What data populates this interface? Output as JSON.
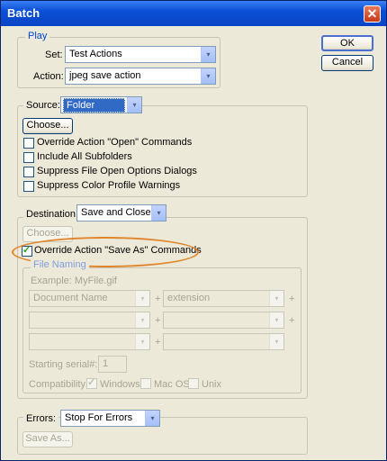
{
  "window": {
    "title": "Batch",
    "close_glyph": "✕"
  },
  "buttons": {
    "ok": "OK",
    "cancel": "Cancel"
  },
  "play": {
    "legend": "Play",
    "set_label": "Set:",
    "set_value": "Test Actions",
    "action_label": "Action:",
    "action_value": "jpeg save action"
  },
  "source": {
    "label": "Source:",
    "value": "Folder",
    "choose": "Choose...",
    "checks": [
      "Override Action \"Open\" Commands",
      "Include All Subfolders",
      "Suppress File Open Options Dialogs",
      "Suppress Color Profile Warnings"
    ]
  },
  "destination": {
    "label": "Destination:",
    "value": "Save and Close",
    "choose": "Choose...",
    "override": "Override Action \"Save As\" Commands",
    "file_naming": {
      "legend": "File Naming",
      "example": "Example: MyFile.gif",
      "row1_left": "Document Name",
      "row1_right": "extension",
      "plus": "+",
      "serial_label": "Starting serial#:",
      "serial_value": "1",
      "compat_label": "Compatibility:",
      "windows": "Windows",
      "macos": "Mac OS",
      "unix": "Unix"
    }
  },
  "errors": {
    "label": "Errors:",
    "value": "Stop For Errors",
    "save_as": "Save As..."
  },
  "icons": {
    "dropdown": "▾",
    "check": "✓"
  },
  "colors": {
    "accent": "#0046d5",
    "highlight": "#316ac5",
    "annotation": "#e0852b"
  }
}
